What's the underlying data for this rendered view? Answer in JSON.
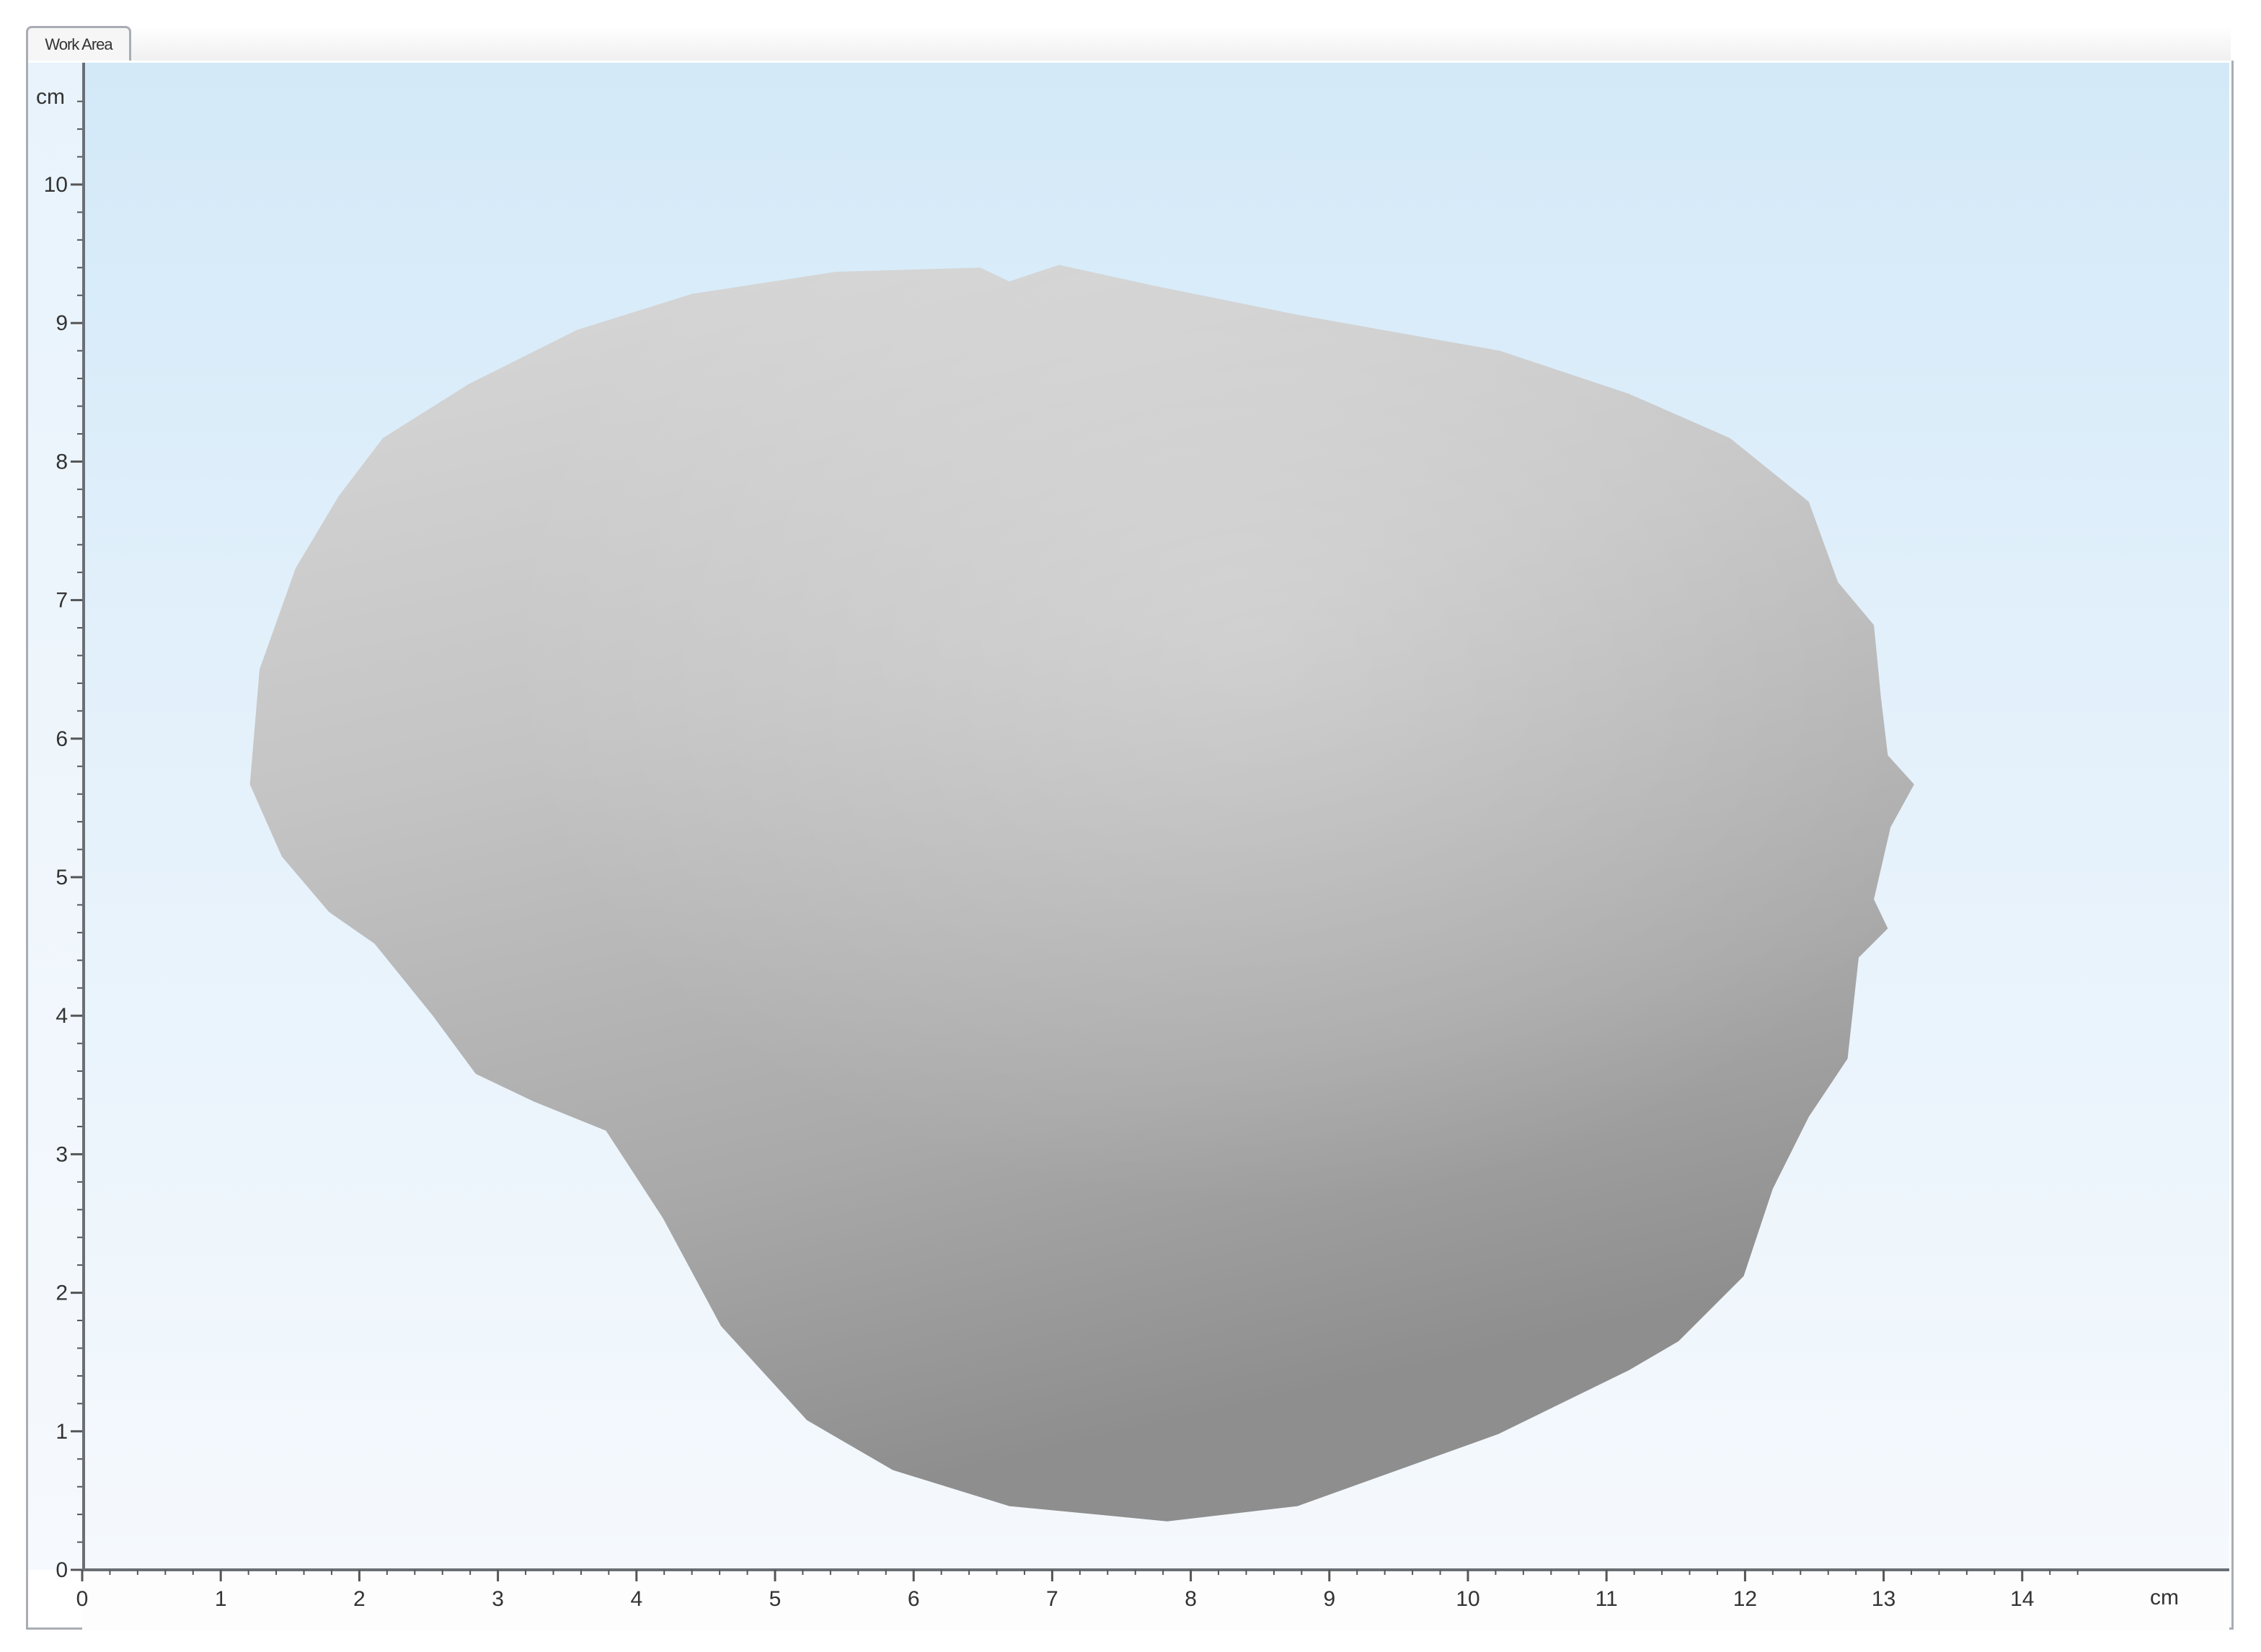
{
  "tab": {
    "label": "Work Area"
  },
  "chart_data": {
    "type": "area",
    "title": "",
    "xlabel": "cm",
    "ylabel": "cm",
    "xlim": [
      0,
      15
    ],
    "ylim": [
      0,
      10.5
    ],
    "x_ticks": [
      "0",
      "1",
      "2",
      "3",
      "4",
      "5",
      "6",
      "7",
      "8",
      "9",
      "10",
      "11",
      "12",
      "13",
      "14"
    ],
    "y_ticks": [
      "0",
      "1",
      "2",
      "3",
      "4",
      "5",
      "6",
      "7",
      "8",
      "9",
      "10"
    ],
    "minor_tick_step": 0.2,
    "shape_description_outline_cm": [
      [
        1.21,
        5.67
      ],
      [
        1.28,
        6.5
      ],
      [
        1.54,
        7.23
      ],
      [
        1.85,
        7.75
      ],
      [
        2.17,
        8.17
      ],
      [
        2.79,
        8.56
      ],
      [
        3.57,
        8.95
      ],
      [
        4.4,
        9.21
      ],
      [
        5.44,
        9.37
      ],
      [
        6.48,
        9.4
      ],
      [
        6.69,
        9.3
      ],
      [
        7.05,
        9.42
      ],
      [
        7.73,
        9.27
      ],
      [
        8.77,
        9.06
      ],
      [
        10.23,
        8.8
      ],
      [
        11.16,
        8.49
      ],
      [
        11.89,
        8.17
      ],
      [
        12.46,
        7.71
      ],
      [
        12.67,
        7.13
      ],
      [
        12.93,
        6.82
      ],
      [
        12.98,
        6.3
      ],
      [
        13.03,
        5.88
      ],
      [
        13.22,
        5.67
      ],
      [
        13.05,
        5.36
      ],
      [
        12.93,
        4.84
      ],
      [
        13.03,
        4.63
      ],
      [
        12.82,
        4.42
      ],
      [
        12.74,
        3.69
      ],
      [
        12.46,
        3.27
      ],
      [
        12.2,
        2.75
      ],
      [
        11.99,
        2.12
      ],
      [
        11.52,
        1.65
      ],
      [
        11.16,
        1.44
      ],
      [
        10.22,
        0.98
      ],
      [
        8.77,
        0.46
      ],
      [
        7.83,
        0.35
      ],
      [
        6.69,
        0.46
      ],
      [
        5.85,
        0.72
      ],
      [
        5.23,
        1.08
      ],
      [
        4.61,
        1.76
      ],
      [
        4.19,
        2.54
      ],
      [
        3.78,
        3.17
      ],
      [
        3.26,
        3.38
      ],
      [
        2.84,
        3.58
      ],
      [
        2.53,
        4.0
      ],
      [
        2.11,
        4.52
      ],
      [
        1.78,
        4.75
      ],
      [
        1.44,
        5.15
      ]
    ]
  }
}
